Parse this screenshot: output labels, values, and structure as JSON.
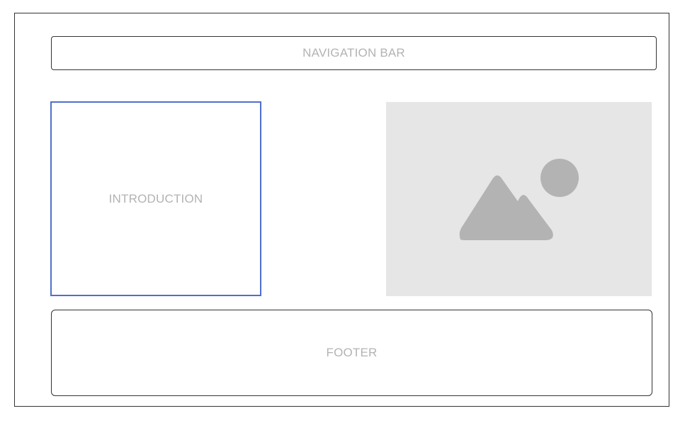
{
  "wireframe": {
    "navigation_bar_label": "NAVIGATION BAR",
    "introduction_label": "INTRODUCTION",
    "footer_label": "FOOTER",
    "image_icon": "image-placeholder-icon"
  },
  "colors": {
    "outline": "#333333",
    "selected_outline": "#4e6fcc",
    "label_text": "#b3b3b3",
    "image_background": "#e6e6e6",
    "image_glyph": "#b3b3b3"
  }
}
